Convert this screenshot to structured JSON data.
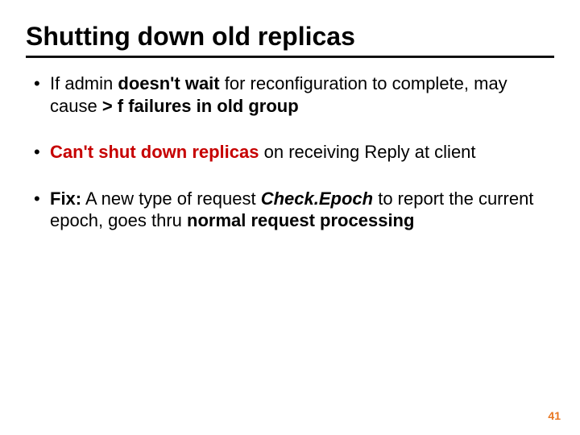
{
  "title": "Shutting down old replicas",
  "bullets": {
    "b1": {
      "p1": "If admin ",
      "p2": "doesn't wait",
      "p3": " for reconfiguration to complete, may cause ",
      "p4": "> f failures in old group"
    },
    "b2": {
      "p1": "Can't shut down replicas",
      "p2": " on receiving Reply at client"
    },
    "b3": {
      "p1": "Fix:",
      "p2": " A new type of request ",
      "p3": "Check.Epoch",
      "p4": " to report the current epoch, goes thru ",
      "p5": "normal request processing"
    }
  },
  "page_number": "41"
}
